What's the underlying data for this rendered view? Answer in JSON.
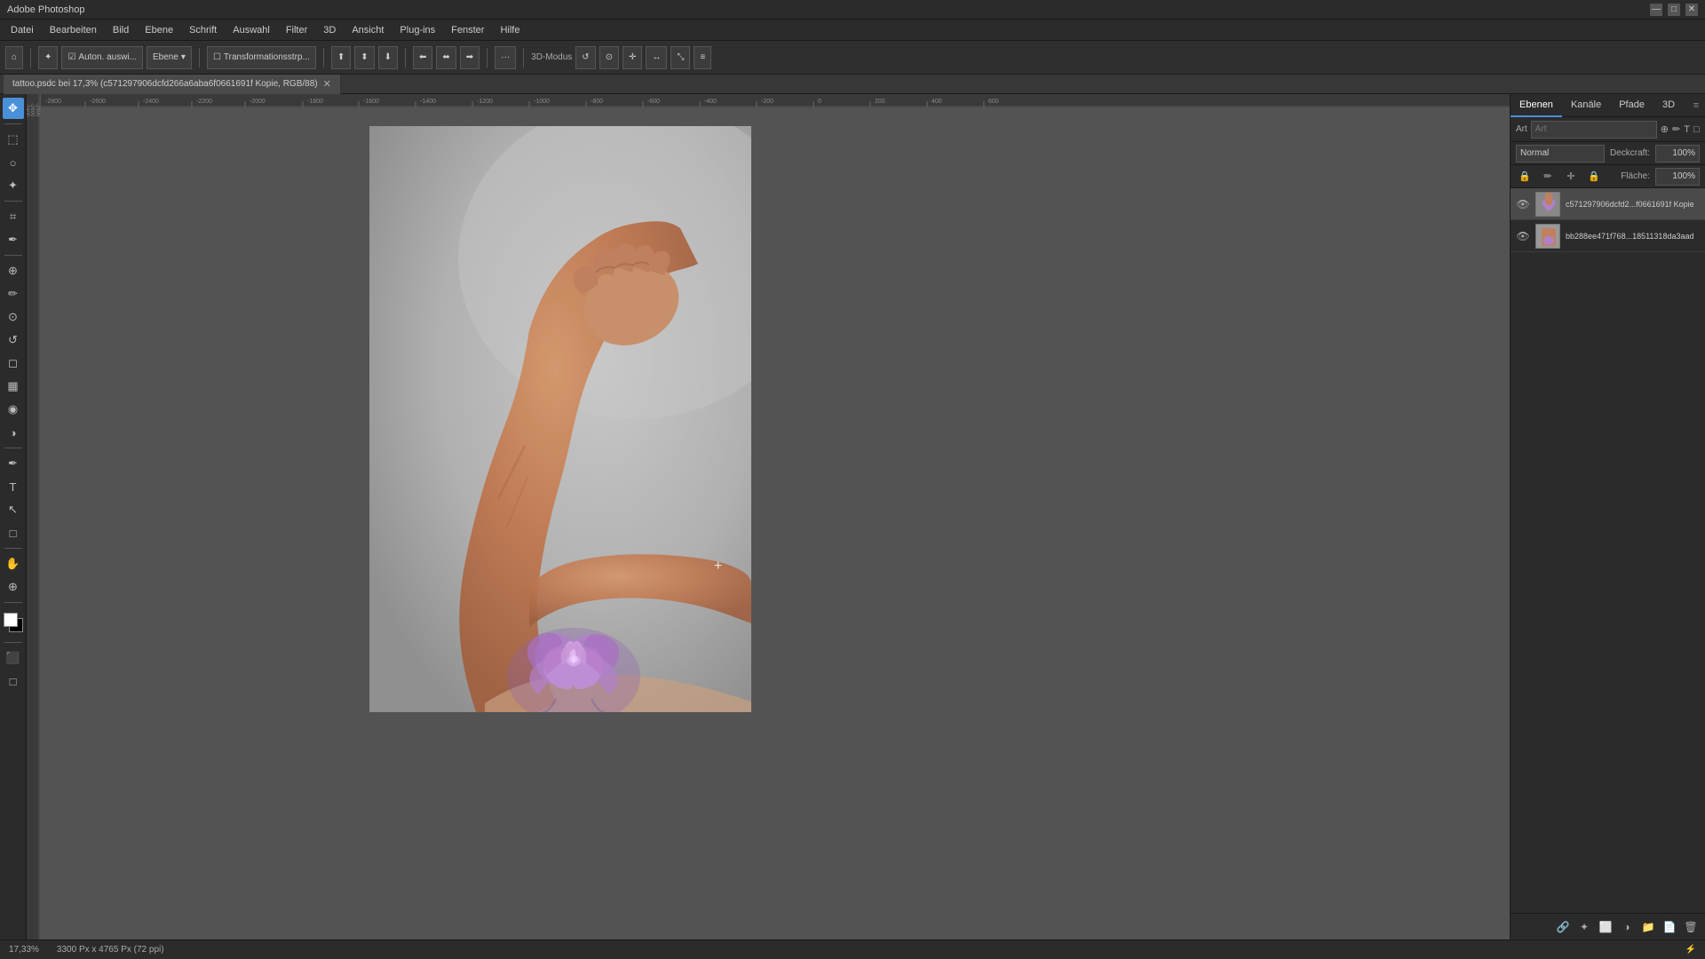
{
  "titlebar": {
    "title": "Adobe Photoshop",
    "minimize": "—",
    "maximize": "□",
    "close": "✕"
  },
  "menubar": {
    "items": [
      "Datei",
      "Bearbeiten",
      "Bild",
      "Ebene",
      "Schrift",
      "Auswahl",
      "Filter",
      "3D",
      "Ansicht",
      "Plug-ins",
      "Fenster",
      "Hilfe"
    ]
  },
  "toolbar": {
    "home_icon": "⌂",
    "tool_icon": "✦",
    "auto_label": "Auton. auswi...",
    "ebene_label": "Ebene",
    "transformations_label": "Transformationsstrp...",
    "more_icon": "···",
    "mode_3d_label": "3D-Modus"
  },
  "doc_tab": {
    "filename": "tattoo.psdc bei 17,3% (c571297906dcfd266a6aba6f0661691f Kopie, RGB/88)",
    "modified": "*",
    "close_icon": "✕"
  },
  "canvas": {
    "zoom": "17,33%",
    "dimensions": "3300 Px x 4765 Px (72 ppi)"
  },
  "right_panel": {
    "tabs": [
      "Ebenen",
      "Kanäle",
      "Pfade",
      "3D"
    ],
    "active_tab": "Ebenen",
    "search_placeholder": "Art",
    "blend_mode": "Normal",
    "opacity_label": "Deckcraft:",
    "opacity_value": "100%",
    "fill_label": "Fläche:",
    "fill_value": "100%",
    "layers": [
      {
        "id": "layer1",
        "name": "c571297906dcfd2...f0661691f Kopie",
        "visible": true,
        "selected": true
      },
      {
        "id": "layer2",
        "name": "bb288ee471f768...18511318da3aad",
        "visible": true,
        "selected": false
      }
    ]
  },
  "left_tools": {
    "tools": [
      {
        "name": "move",
        "icon": "✥"
      },
      {
        "name": "marquee",
        "icon": "⬚"
      },
      {
        "name": "lasso",
        "icon": "◎"
      },
      {
        "name": "quick-select",
        "icon": "✦"
      },
      {
        "name": "crop",
        "icon": "⌗"
      },
      {
        "name": "eyedropper",
        "icon": "✒"
      },
      {
        "name": "heal",
        "icon": "⊕"
      },
      {
        "name": "brush",
        "icon": "✏"
      },
      {
        "name": "stamp",
        "icon": "⊙"
      },
      {
        "name": "history-brush",
        "icon": "↺"
      },
      {
        "name": "eraser",
        "icon": "◻"
      },
      {
        "name": "gradient",
        "icon": "▦"
      },
      {
        "name": "blur",
        "icon": "◉"
      },
      {
        "name": "dodge",
        "icon": "◑"
      },
      {
        "name": "pen",
        "icon": "✒"
      },
      {
        "name": "text",
        "icon": "T"
      },
      {
        "name": "path-select",
        "icon": "↖"
      },
      {
        "name": "shape",
        "icon": "□"
      },
      {
        "name": "hand",
        "icon": "✋"
      },
      {
        "name": "zoom",
        "icon": "⊕"
      }
    ]
  },
  "statusbar": {
    "zoom": "17,33%",
    "dimensions": "3300 Px x 4765 Px (72 ppi)"
  }
}
